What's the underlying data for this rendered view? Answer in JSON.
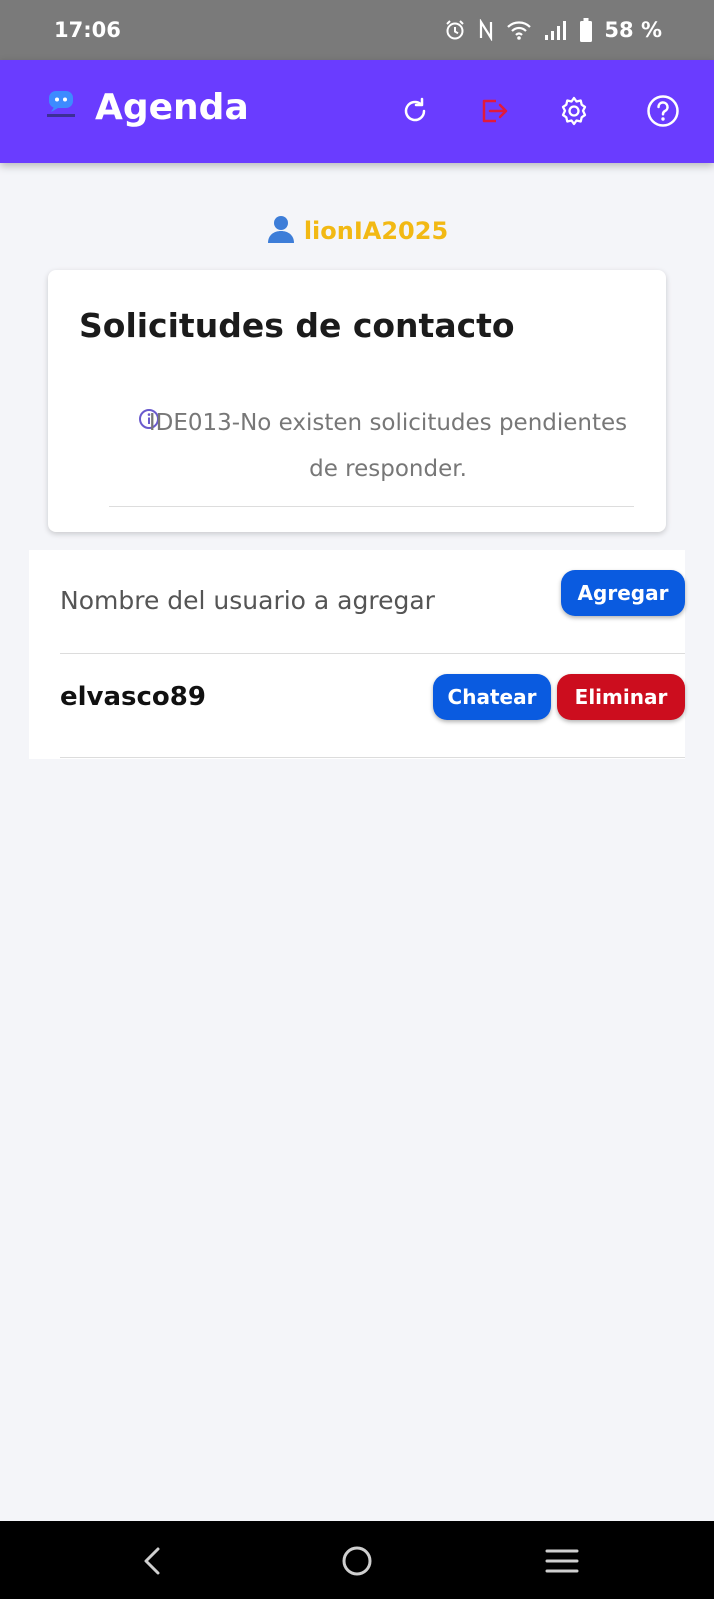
{
  "status_bar": {
    "time": "17:06",
    "battery": "58 %",
    "icons": [
      "alarm-icon",
      "nfc-icon",
      "wifi-icon",
      "signal-icon",
      "battery-icon"
    ]
  },
  "app_bar": {
    "logo_icon": "chat-logo-icon",
    "title": "Agenda",
    "actions": [
      "refresh-icon",
      "logout-icon",
      "settings-gear-icon",
      "help-icon"
    ],
    "logout_color": "#e01a3c",
    "background": "#6a3cff"
  },
  "user": {
    "username": "lionIA2025",
    "icon": "person-icon",
    "color": "#f2b914"
  },
  "requests_card": {
    "title": "Solicitudes de contacto",
    "info_icon": "info-icon",
    "message": "IDE013-No existen solicitudes pendientes de responder."
  },
  "add_contact": {
    "placeholder": "Nombre del usuario a agregar",
    "value": "",
    "button_label": "Agregar"
  },
  "contacts": [
    {
      "name": "elvasco89",
      "chat_label": "Chatear",
      "delete_label": "Eliminar"
    }
  ],
  "nav_bar": {
    "buttons": [
      "back-icon",
      "home-icon",
      "recents-icon"
    ]
  }
}
